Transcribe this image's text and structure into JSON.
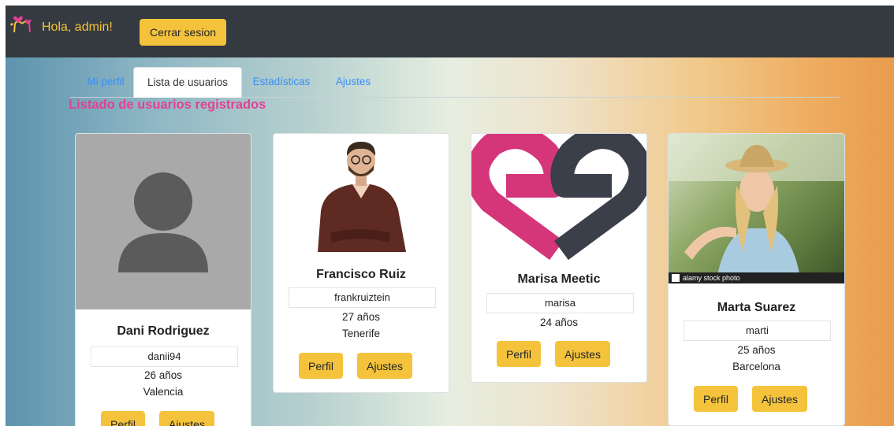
{
  "navbar": {
    "logo_icon": "hearts-logo-icon",
    "greeting": "Hola, admin!",
    "logout_label": "Cerrar sesion"
  },
  "tabs": [
    {
      "label": "Mi perfil",
      "active": false
    },
    {
      "label": "Lista de usuarios",
      "active": true
    },
    {
      "label": "Estadísticas",
      "active": false
    },
    {
      "label": "Ajustes",
      "active": false
    }
  ],
  "heading": "Listado de usuarios registrados",
  "users": [
    {
      "name": "Dani Rodriguez",
      "username": "danii94",
      "age": "26 años",
      "city": "Valencia",
      "photo": "default-avatar-icon",
      "profile_label": "Perfil",
      "settings_label": "Ajustes"
    },
    {
      "name": "Francisco Ruiz",
      "username": "frankruiztein",
      "age": "27 años",
      "city": "Tenerife",
      "photo": "man-portrait-photo",
      "profile_label": "Perfil",
      "settings_label": "Ajustes"
    },
    {
      "name": "Marisa Meetic",
      "username": "marisa",
      "age": "24 años",
      "city": "",
      "photo": "meetic-logo",
      "profile_label": "Perfil",
      "settings_label": "Ajustes"
    },
    {
      "name": "Marta Suarez",
      "username": "marti",
      "age": "25 años",
      "city": "Barcelona",
      "photo": "woman-selfie-photo",
      "photo_caption": "alamy stock photo",
      "profile_label": "Perfil",
      "settings_label": "Ajustes"
    }
  ],
  "colors": {
    "navbar_bg": "#343a40",
    "accent_yellow": "#f5c33b",
    "heading_pink": "#e44093",
    "tab_link_blue": "#3a8ef6"
  }
}
